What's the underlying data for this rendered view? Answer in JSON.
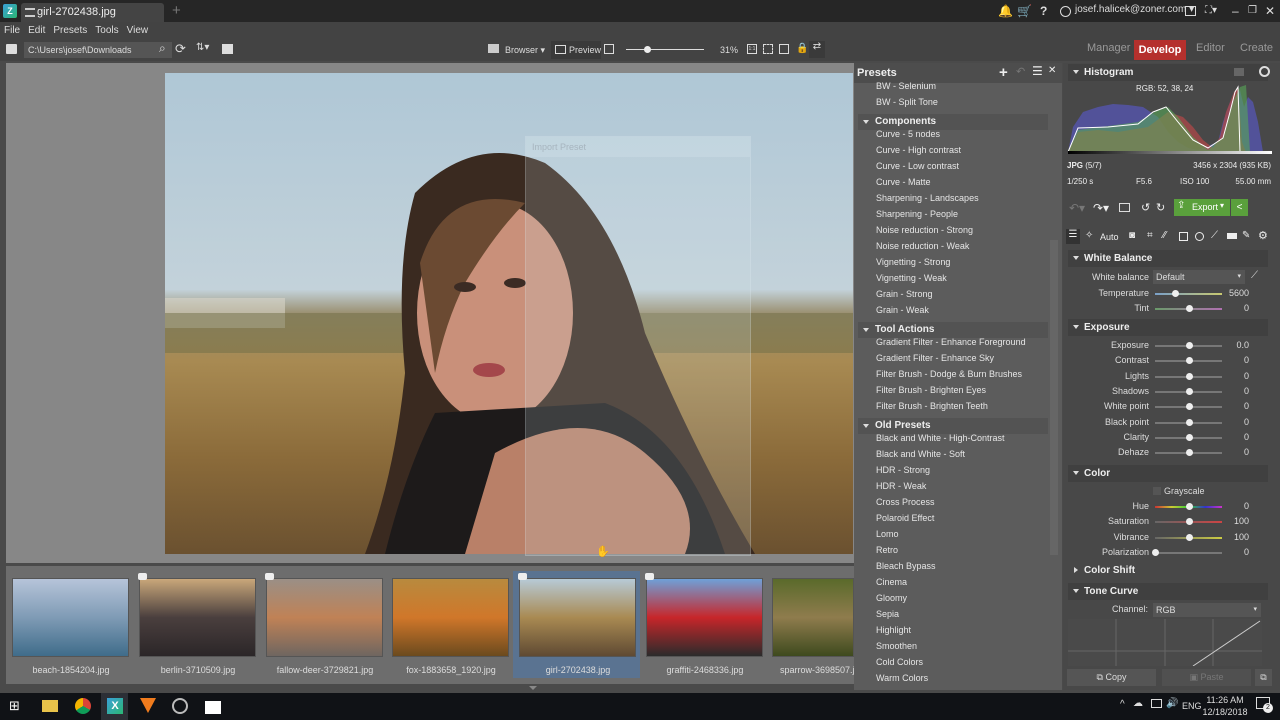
{
  "window": {
    "tab_title": "girl-2702438.jpg",
    "user": "josef.halicek@zoner.com"
  },
  "menu": [
    "File",
    "Edit",
    "Presets",
    "Tools",
    "View"
  ],
  "toolbar": {
    "path": "C:\\Users\\josef\\Downloads",
    "browser_label": "Browser",
    "preview_label": "Preview",
    "zoom_value": "31%",
    "zoom_fraction": 0.1
  },
  "modes": {
    "manager": "Manager",
    "develop": "Develop",
    "editor": "Editor",
    "create": "Create"
  },
  "overlay": {
    "title": "Import Preset"
  },
  "filmstrip": [
    {
      "name": "beach-1854204.jpg",
      "colors": [
        "#b6c4d9",
        "#7f9bb5",
        "#3f6c8a"
      ]
    },
    {
      "name": "berlin-3710509.jpg",
      "colors": [
        "#c9a77a",
        "#4a3f3e",
        "#2b2628"
      ]
    },
    {
      "name": "fallow-deer-3729821.jpg",
      "colors": [
        "#9a8f86",
        "#c08256",
        "#6f6660"
      ]
    },
    {
      "name": "fox-1883658_1920.jpg",
      "colors": [
        "#b88a3e",
        "#d0772a",
        "#6b4a1e"
      ]
    },
    {
      "name": "girl-2702438.jpg",
      "colors": [
        "#b7cad6",
        "#a98a52",
        "#5f4a33"
      ],
      "selected": true
    },
    {
      "name": "graffiti-2468336.jpg",
      "colors": [
        "#6fa0d8",
        "#c7262a",
        "#2b2b2b"
      ]
    },
    {
      "name": "sparrow-3698507.jpg",
      "colors": [
        "#5a6a2b",
        "#8f7c4d",
        "#3e4a1e"
      ]
    }
  ],
  "presets": {
    "title": "Presets",
    "items": [
      {
        "type": "item",
        "label": "BW - Selenium"
      },
      {
        "type": "item",
        "label": "BW - Split Tone"
      },
      {
        "type": "group",
        "label": "Components"
      },
      {
        "type": "item",
        "label": "Curve - 5 nodes"
      },
      {
        "type": "item",
        "label": "Curve - High contrast"
      },
      {
        "type": "item",
        "label": "Curve - Low contrast"
      },
      {
        "type": "item",
        "label": "Curve - Matte"
      },
      {
        "type": "item",
        "label": "Sharpening - Landscapes"
      },
      {
        "type": "item",
        "label": "Sharpening - People"
      },
      {
        "type": "item",
        "label": "Noise reduction - Strong"
      },
      {
        "type": "item",
        "label": "Noise reduction - Weak"
      },
      {
        "type": "item",
        "label": "Vignetting - Strong"
      },
      {
        "type": "item",
        "label": "Vignetting - Weak"
      },
      {
        "type": "item",
        "label": "Grain - Strong"
      },
      {
        "type": "item",
        "label": "Grain - Weak"
      },
      {
        "type": "group",
        "label": "Tool Actions"
      },
      {
        "type": "item",
        "label": "Gradient Filter - Enhance Foreground"
      },
      {
        "type": "item",
        "label": "Gradient Filter - Enhance Sky"
      },
      {
        "type": "item",
        "label": "Filter Brush - Dodge & Burn Brushes"
      },
      {
        "type": "item",
        "label": "Filter Brush - Brighten Eyes"
      },
      {
        "type": "item",
        "label": "Filter Brush - Brighten Teeth"
      },
      {
        "type": "group",
        "label": "Old Presets"
      },
      {
        "type": "item",
        "label": "Black and White - High-Contrast"
      },
      {
        "type": "item",
        "label": "Black and White - Soft"
      },
      {
        "type": "item",
        "label": "HDR - Strong"
      },
      {
        "type": "item",
        "label": "HDR - Weak"
      },
      {
        "type": "item",
        "label": "Cross Process"
      },
      {
        "type": "item",
        "label": "Polaroid Effect"
      },
      {
        "type": "item",
        "label": "Lomo"
      },
      {
        "type": "item",
        "label": "Retro"
      },
      {
        "type": "item",
        "label": "Bleach Bypass"
      },
      {
        "type": "item",
        "label": "Cinema"
      },
      {
        "type": "item",
        "label": "Gloomy"
      },
      {
        "type": "item",
        "label": "Sepia"
      },
      {
        "type": "item",
        "label": "Highlight"
      },
      {
        "type": "item",
        "label": "Smoothen"
      },
      {
        "type": "item",
        "label": "Cold Colors"
      },
      {
        "type": "item",
        "label": "Warm Colors"
      }
    ]
  },
  "histogram": {
    "title": "Histogram",
    "rgb": "RGB: 52, 38, 24",
    "format": "JPG",
    "index": "(5/7)",
    "dimensions": "3456 x 2304 (935 KB)",
    "shutter": "1/250 s",
    "aperture": "F5.6",
    "iso": "ISO 100",
    "focal": "55.00 mm"
  },
  "actions": {
    "export": "Export",
    "auto": "Auto"
  },
  "white_balance": {
    "title": "White Balance",
    "wb_label": "White balance",
    "wb_value": "Default",
    "sliders": [
      {
        "label": "Temperature",
        "value": "5600",
        "pos": 0.3
      },
      {
        "label": "Tint",
        "value": "0",
        "pos": 0.5
      }
    ]
  },
  "exposure": {
    "title": "Exposure",
    "sliders": [
      {
        "label": "Exposure",
        "value": "0.0",
        "pos": 0.5
      },
      {
        "label": "Contrast",
        "value": "0",
        "pos": 0.5
      },
      {
        "label": "Lights",
        "value": "0",
        "pos": 0.5
      },
      {
        "label": "Shadows",
        "value": "0",
        "pos": 0.5
      },
      {
        "label": "White point",
        "value": "0",
        "pos": 0.5
      },
      {
        "label": "Black point",
        "value": "0",
        "pos": 0.5
      },
      {
        "label": "Clarity",
        "value": "0",
        "pos": 0.5
      },
      {
        "label": "Dehaze",
        "value": "0",
        "pos": 0.5
      }
    ]
  },
  "color": {
    "title": "Color",
    "grayscale": "Grayscale",
    "sliders": [
      {
        "label": "Hue",
        "value": "0",
        "pos": 0.5
      },
      {
        "label": "Saturation",
        "value": "100",
        "pos": 0.5
      },
      {
        "label": "Vibrance",
        "value": "100",
        "pos": 0.5
      },
      {
        "label": "Polarization",
        "value": "0",
        "pos": 0.0
      }
    ]
  },
  "color_shift": {
    "title": "Color Shift"
  },
  "tone_curve": {
    "title": "Tone Curve",
    "channel_label": "Channel:",
    "channel_value": "RGB"
  },
  "bottom_buttons": {
    "copy": "Copy",
    "paste": "Paste"
  },
  "taskbar": {
    "time": "11:26 AM",
    "date": "12/18/2018",
    "lang": "ENG",
    "notifications": "2"
  }
}
